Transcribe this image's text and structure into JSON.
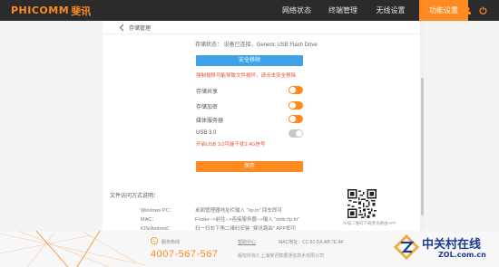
{
  "brand": {
    "logo_en": "PHICOMM",
    "logo_cn": "斐讯"
  },
  "nav": {
    "items": [
      {
        "label": "网络状态",
        "active": false
      },
      {
        "label": "终端管理",
        "active": false
      },
      {
        "label": "无线设置",
        "active": false
      },
      {
        "label": "功能设置",
        "active": true
      }
    ],
    "icons": [
      "user-icon",
      "power-icon"
    ]
  },
  "page": {
    "title": "存储管理",
    "status": "存储状态：  设备已连接，Generic USB Flash Drive",
    "safe_remove_label": "安全移除",
    "warning": "强制拔移可能导致文件损坏，请点击安全移除",
    "toggles": [
      {
        "label": "存储共享",
        "state": "on"
      },
      {
        "label": "存储加密",
        "state": "on"
      },
      {
        "label": "媒体服务器",
        "state": "on"
      },
      {
        "label": "USB 3.0",
        "state": "off"
      }
    ],
    "usb_note": "开启USB 3.0可能干扰2.4G信号",
    "save_label": "保存",
    "access": {
      "title": "文件访问方式说明：",
      "rows": [
        {
          "key": "Windows PC：",
          "value": "桌面管理器地址栏输入 “\\\\p.to” 回车即可"
        },
        {
          "key": "MAC：",
          "value": "Finder-->前往-->连接服务器-->输入 “smb://p.to”"
        },
        {
          "key": "iOS/Android：",
          "value": "扫一扫右下角二维码安装 “斐讯路由” APP即可"
        }
      ]
    },
    "qr_caption": "扫描二维码下载斐讯路由APP"
  },
  "footer": {
    "hotline_label": "服务热线",
    "hotline": "4007-567-567",
    "link": "帮助中心",
    "mac": "MAC地址：CC:81:DA:AB:7E:AF",
    "copyright": "版权所有© 上海斐讯数据通信技术有限公司"
  },
  "watermark": {
    "cn": "中关村在线",
    "en": "ZOL.com.cn"
  },
  "colors": {
    "accent": "#ff8a1f",
    "blue_button": "#3da2e8",
    "nav_bg": "#2b2b2b",
    "warning": "#e54d2e"
  }
}
